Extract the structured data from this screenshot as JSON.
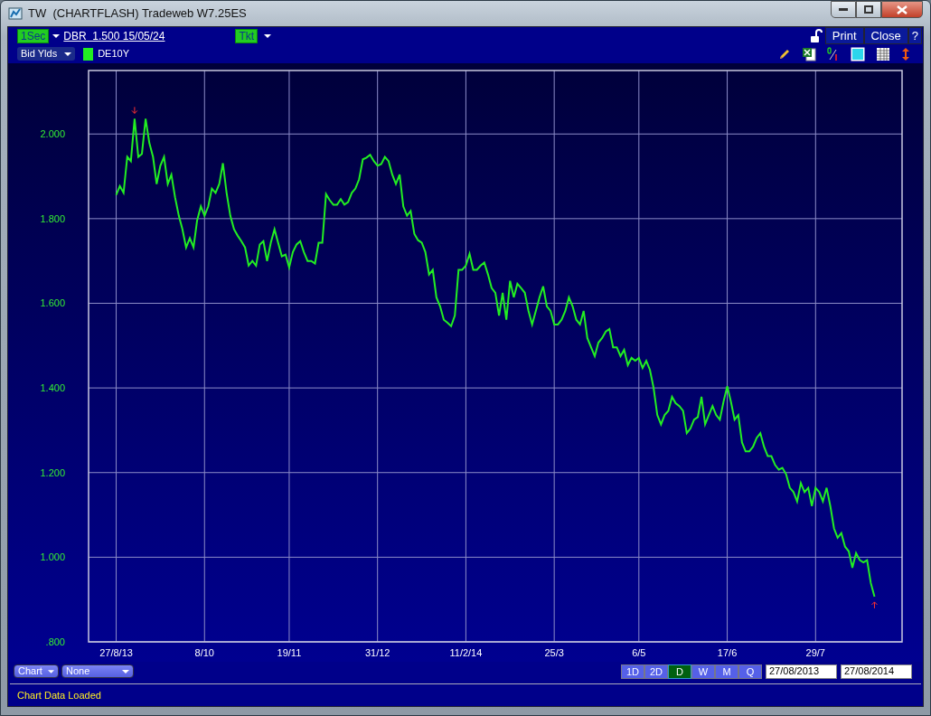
{
  "window": {
    "title": "TW  (CHARTFLASH) Tradeweb W7.25ES"
  },
  "toolbar": {
    "interval": "1Sec",
    "instrument": "DBR  1.500 15/05/24",
    "ticket": "Tkt",
    "buttons": [
      "Print",
      "Close",
      "?"
    ]
  },
  "series_selector": {
    "value": "Bid Ylds"
  },
  "chart_data": {
    "type": "line",
    "grid": true,
    "ylim": [
      0.8,
      2.15
    ],
    "categories": [
      "27/8/13",
      null,
      null,
      null,
      null,
      null,
      null,
      null,
      null,
      null,
      null,
      null,
      null,
      null,
      null,
      null,
      null,
      null,
      null,
      null,
      null,
      null,
      null,
      null,
      "8/10",
      null,
      null,
      null,
      null,
      null,
      null,
      null,
      null,
      null,
      null,
      null,
      null,
      null,
      null,
      null,
      null,
      null,
      null,
      null,
      null,
      null,
      null,
      "19/11",
      null,
      null,
      null,
      null,
      null,
      null,
      null,
      null,
      null,
      null,
      null,
      null,
      null,
      null,
      null,
      null,
      null,
      null,
      null,
      null,
      null,
      null,
      null,
      "31/12",
      null,
      null,
      null,
      null,
      null,
      null,
      null,
      null,
      null,
      null,
      null,
      null,
      null,
      null,
      null,
      null,
      null,
      null,
      null,
      null,
      null,
      null,
      null,
      "11/2/14",
      null,
      null,
      null,
      null,
      null,
      null,
      null,
      null,
      null,
      null,
      null,
      null,
      null,
      null,
      null,
      null,
      null,
      null,
      null,
      null,
      null,
      null,
      null,
      "25/3",
      null,
      null,
      null,
      null,
      null,
      null,
      null,
      null,
      null,
      null,
      null,
      null,
      null,
      null,
      null,
      null,
      null,
      null,
      null,
      null,
      null,
      null,
      "6/5",
      null,
      null,
      null,
      null,
      null,
      null,
      null,
      null,
      null,
      null,
      null,
      null,
      null,
      null,
      null,
      null,
      null,
      null,
      null,
      null,
      null,
      null,
      null,
      "17/6",
      null,
      null,
      null,
      null,
      null,
      null,
      null,
      null,
      null,
      null,
      null,
      null,
      null,
      null,
      null,
      null,
      null,
      null,
      null,
      null,
      null,
      null,
      null,
      "29/7",
      null,
      null,
      null,
      null,
      null,
      null,
      null,
      null,
      null,
      null,
      null,
      null,
      null,
      null,
      null,
      null
    ],
    "yticks": [
      {
        "value": 0.8,
        "label": ".800"
      },
      {
        "value": 1.0,
        "label": "1.000"
      },
      {
        "value": 1.2,
        "label": "1.200"
      },
      {
        "value": 1.4,
        "label": "1.400"
      },
      {
        "value": 1.6,
        "label": "1.600"
      },
      {
        "value": 1.8,
        "label": "1.800"
      },
      {
        "value": 2.0,
        "label": "2.000"
      }
    ],
    "series": [
      {
        "name": "DE10Y",
        "color": "#22ee22",
        "values": [
          1.856,
          1.877,
          1.861,
          1.946,
          1.936,
          2.036,
          1.946,
          1.953,
          2.036,
          1.979,
          1.946,
          1.882,
          1.925,
          1.946,
          1.882,
          1.904,
          1.85,
          1.807,
          1.775,
          1.732,
          1.754,
          1.732,
          1.796,
          1.829,
          1.807,
          1.829,
          1.871,
          1.861,
          1.882,
          1.931,
          1.861,
          1.807,
          1.775,
          1.76,
          1.747,
          1.732,
          1.689,
          1.7,
          1.689,
          1.739,
          1.747,
          1.7,
          1.743,
          1.775,
          1.743,
          1.711,
          1.715,
          1.685,
          1.721,
          1.739,
          1.747,
          1.721,
          1.7,
          1.7,
          1.694,
          1.743,
          1.743,
          1.858,
          1.844,
          1.833,
          1.833,
          1.846,
          1.833,
          1.839,
          1.861,
          1.871,
          1.893,
          1.94,
          1.944,
          1.951,
          1.936,
          1.925,
          1.929,
          1.946,
          1.936,
          1.904,
          1.882,
          1.904,
          1.829,
          1.807,
          1.818,
          1.764,
          1.749,
          1.743,
          1.721,
          1.668,
          1.679,
          1.614,
          1.593,
          1.561,
          1.554,
          1.546,
          1.571,
          1.679,
          1.679,
          1.689,
          1.717,
          1.679,
          1.679,
          1.689,
          1.696,
          1.668,
          1.636,
          1.625,
          1.571,
          1.625,
          1.561,
          1.653,
          1.614,
          1.646,
          1.636,
          1.625,
          1.582,
          1.55,
          1.582,
          1.614,
          1.64,
          1.593,
          1.582,
          1.55,
          1.55,
          1.561,
          1.582,
          1.614,
          1.593,
          1.561,
          1.55,
          1.582,
          1.518,
          1.496,
          1.475,
          1.507,
          1.518,
          1.533,
          1.539,
          1.496,
          1.496,
          1.475,
          1.49,
          1.454,
          1.471,
          1.464,
          1.471,
          1.447,
          1.464,
          1.443,
          1.4,
          1.336,
          1.314,
          1.336,
          1.346,
          1.379,
          1.364,
          1.357,
          1.346,
          1.293,
          1.304,
          1.325,
          1.331,
          1.379,
          1.314,
          1.336,
          1.357,
          1.336,
          1.325,
          1.368,
          1.404,
          1.368,
          1.325,
          1.336,
          1.271,
          1.25,
          1.25,
          1.261,
          1.282,
          1.293,
          1.261,
          1.239,
          1.239,
          1.218,
          1.207,
          1.211,
          1.196,
          1.164,
          1.154,
          1.132,
          1.175,
          1.154,
          1.164,
          1.121,
          1.164,
          1.154,
          1.132,
          1.164,
          1.121,
          1.068,
          1.046,
          1.057,
          1.025,
          1.014,
          0.975,
          1.01,
          0.993,
          0.988,
          0.993,
          0.939,
          0.907
        ]
      }
    ]
  },
  "chart_type_select": {
    "value": "Chart"
  },
  "overlay_select": {
    "value": "None"
  },
  "periods": [
    {
      "label": "1D",
      "selected": false
    },
    {
      "label": "2D",
      "selected": false
    },
    {
      "label": "D",
      "selected": true
    },
    {
      "label": "W",
      "selected": false
    },
    {
      "label": "M",
      "selected": false
    },
    {
      "label": "Q",
      "selected": false
    }
  ],
  "date_from": {
    "value": "27/08/2013"
  },
  "date_to": {
    "value": "27/08/2014"
  },
  "status_bar": "Chart Data Loaded"
}
